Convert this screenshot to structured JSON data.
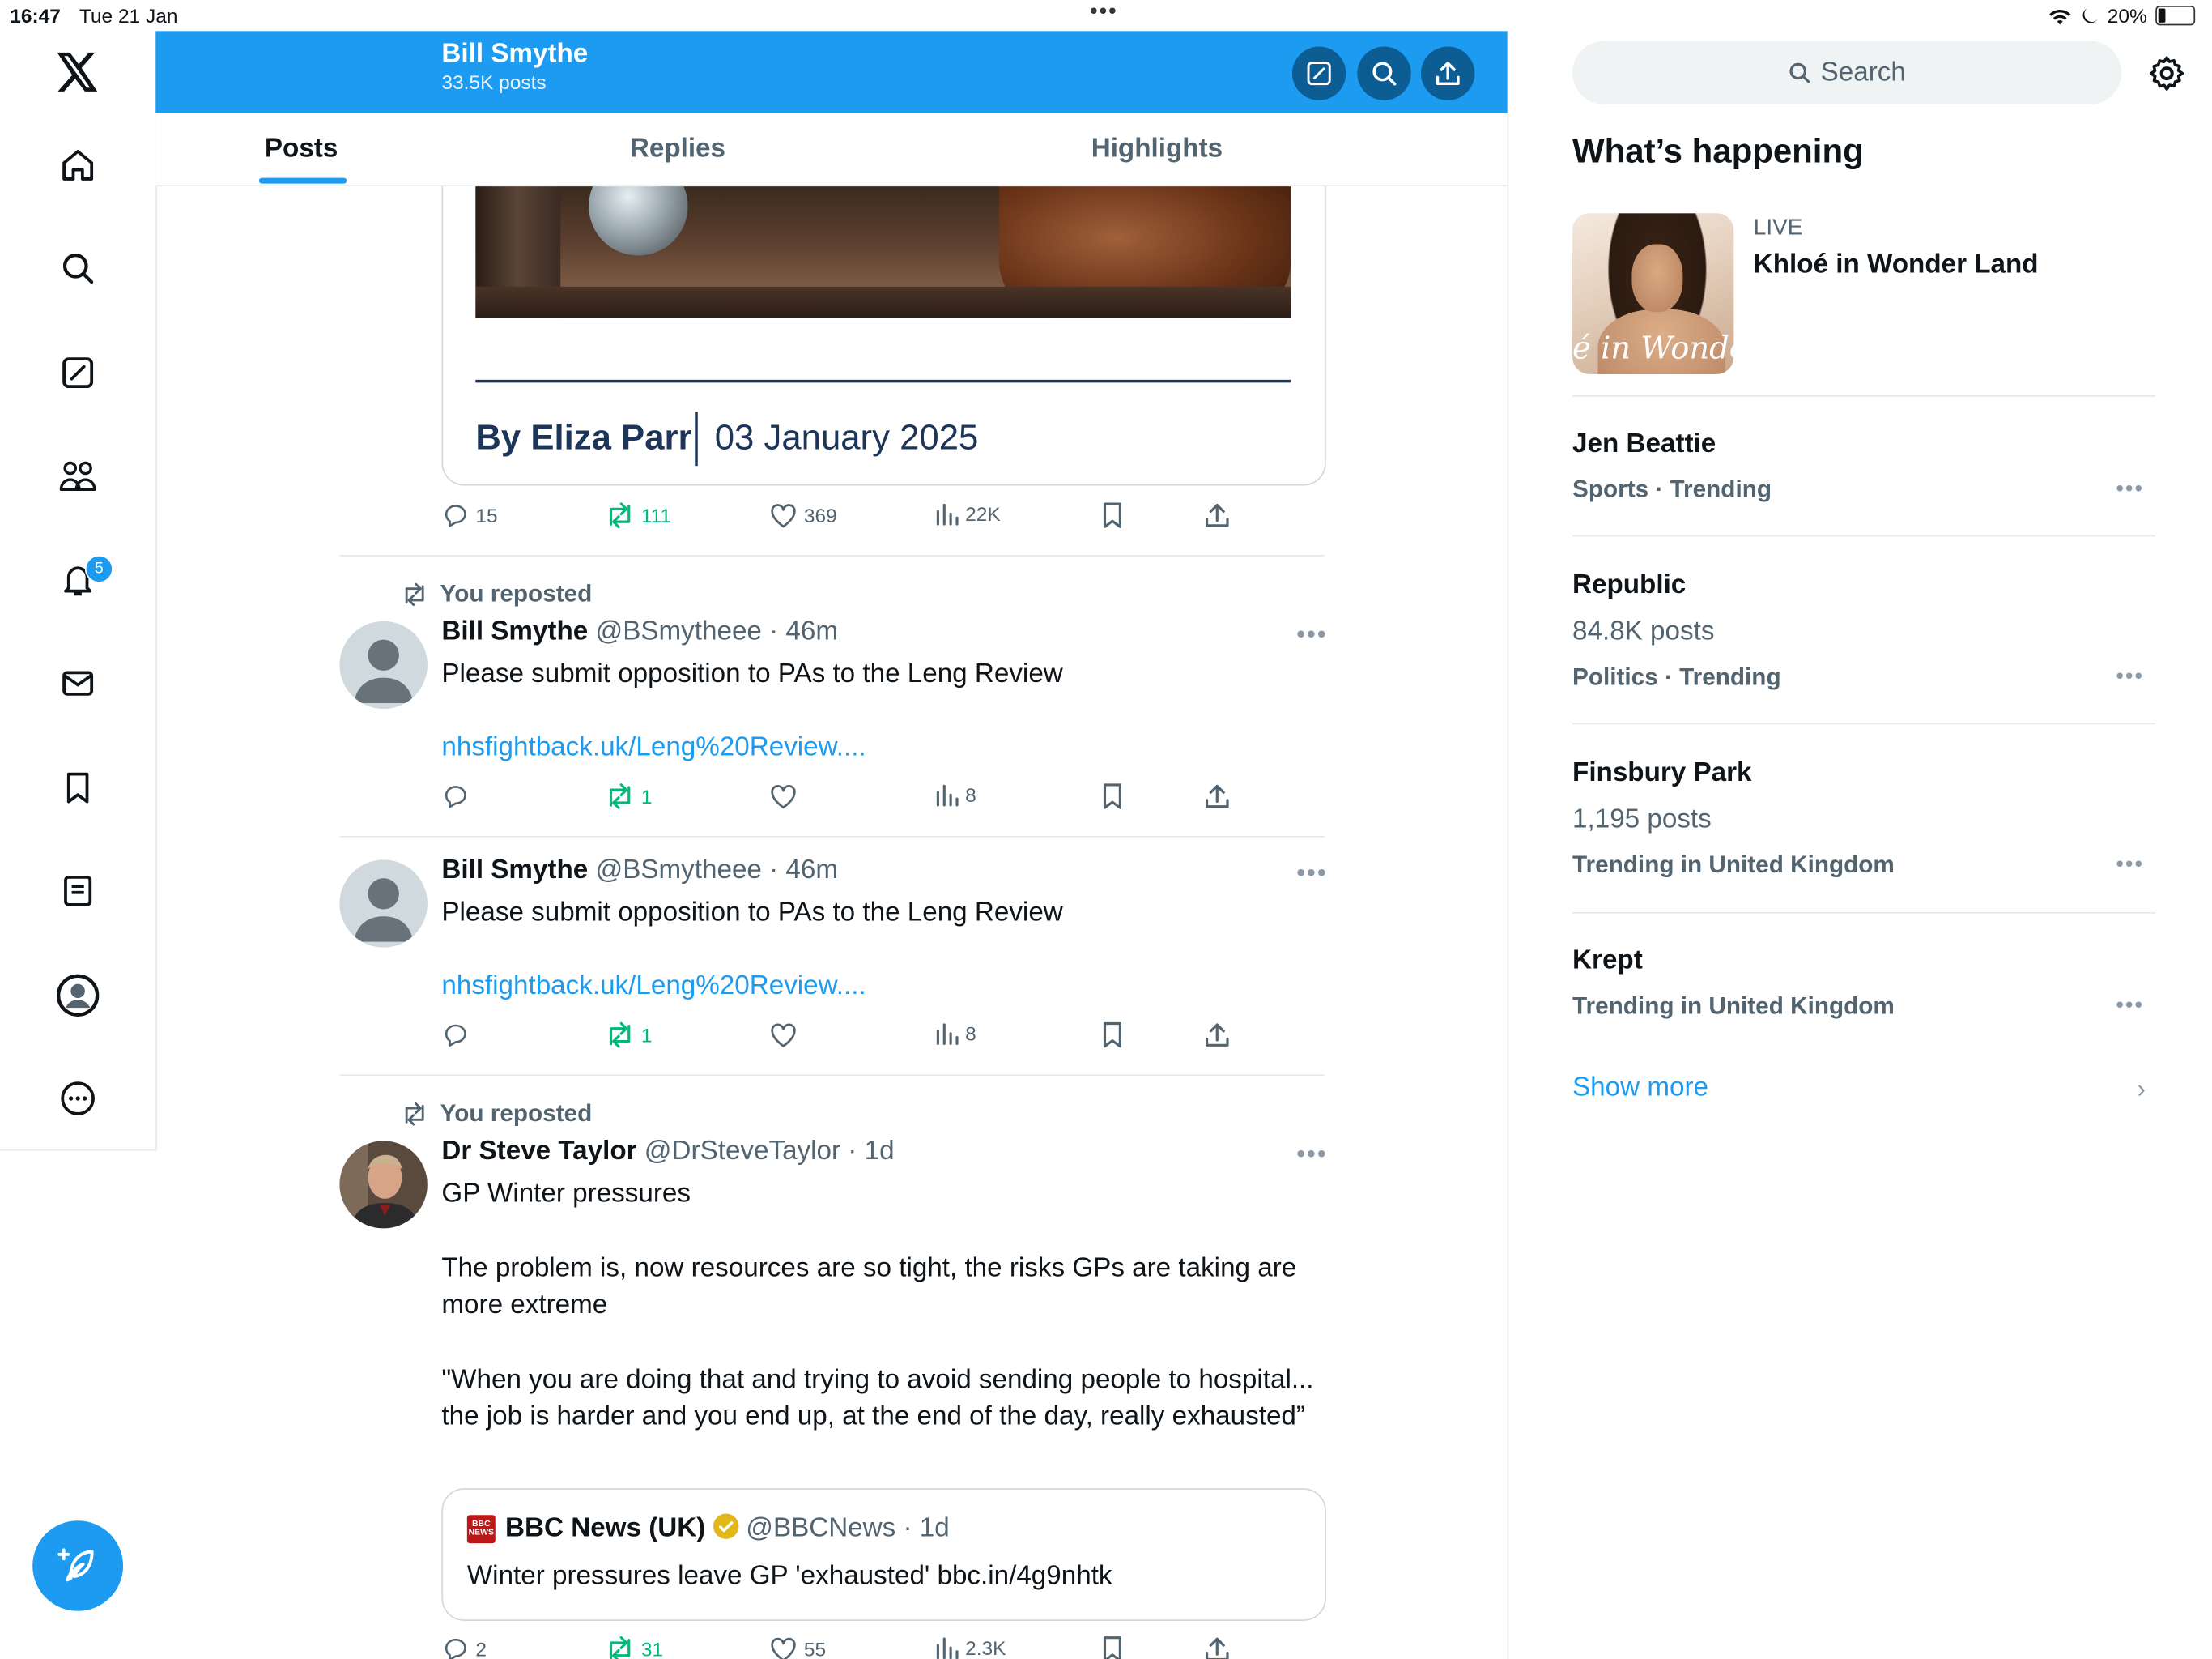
{
  "status_bar": {
    "time": "16:47",
    "date": "Tue 21 Jan",
    "battery": "20%"
  },
  "nav": {
    "notifications_badge": "5",
    "items": [
      "x-logo",
      "home",
      "search",
      "compose",
      "communities",
      "notifications",
      "messages",
      "bookmarks",
      "lists",
      "profile",
      "more"
    ]
  },
  "header": {
    "name": "Bill Smythe",
    "posts_count": "33.5K posts"
  },
  "tabs": [
    {
      "label": "Posts"
    },
    {
      "label": "Replies"
    },
    {
      "label": "Highlights"
    }
  ],
  "card": {
    "author": "By Eliza Parr",
    "date": "03 January 2025",
    "actions": {
      "replies": "15",
      "reposts": "111",
      "likes": "369",
      "views": "22K"
    }
  },
  "posts": [
    {
      "repost_label": "You reposted",
      "name": "Bill Smythe",
      "handle_time": "@BSmytheee · 46m",
      "text": "Please submit opposition to PAs to the Leng Review",
      "link": "nhsfightback.uk/Leng%20Review....",
      "actions": {
        "replies": "",
        "reposts": "1",
        "likes": "",
        "views": "8"
      }
    },
    {
      "name": "Bill Smythe",
      "handle_time": "@BSmytheee · 46m",
      "text": "Please submit opposition to PAs to the Leng Review",
      "link": "nhsfightback.uk/Leng%20Review....",
      "actions": {
        "replies": "",
        "reposts": "1",
        "likes": "",
        "views": "8"
      }
    },
    {
      "repost_label": "You reposted",
      "name": "Dr Steve Taylor",
      "handle_time": "@DrSteveTaylor · 1d",
      "text_1": "GP Winter pressures",
      "text_2": "The problem is, now resources are so tight, the risks GPs are taking are more extreme",
      "text_3": "\"When you are doing that and trying to avoid sending people to hospital... the job is harder and you end up, at the end of the day, really exhausted”",
      "quote": {
        "logo_text": "BBC NEWS",
        "name": "BBC News (UK)",
        "handle_time": "@BBCNews · 1d",
        "text": "Winter pressures leave GP 'exhausted' bbc.in/4g9nhtk"
      },
      "actions": {
        "replies": "2",
        "reposts": "31",
        "likes": "55",
        "views": "2.3K"
      }
    }
  ],
  "sidebar": {
    "search_placeholder": "Search",
    "title": "What’s happening",
    "live": {
      "label": "LIVE",
      "title": "Khloé in Wonder Land",
      "image_text": "é in Wonder L"
    },
    "trends": [
      {
        "name": "Jen Beattie",
        "category": "Sports · Trending"
      },
      {
        "name": "Republic",
        "count": "84.8K posts",
        "category": "Politics · Trending"
      },
      {
        "name": "Finsbury Park",
        "count": "1,195 posts",
        "category": "Trending in United Kingdom"
      },
      {
        "name": "Krept",
        "category": "Trending in United Kingdom"
      }
    ],
    "show_more": "Show more"
  },
  "colors": {
    "accent": "#1d9bf0",
    "repost_green": "#00ba7c",
    "text_secondary": "#536471"
  }
}
